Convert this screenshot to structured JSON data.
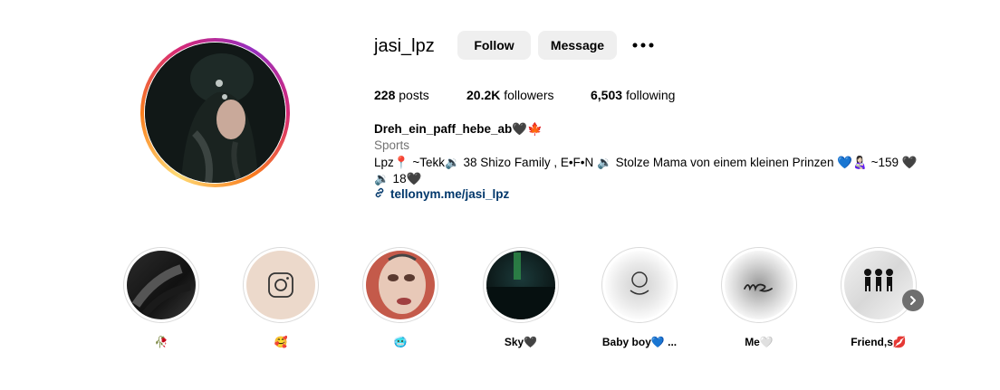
{
  "profile": {
    "username": "jasi_lpz",
    "follow_label": "Follow",
    "message_label": "Message",
    "stats": {
      "posts_count": "228",
      "posts_label": "posts",
      "followers_count": "20.2K",
      "followers_label": "followers",
      "following_count": "6,503",
      "following_label": "following"
    },
    "display_name": "Dreh_ein_paff_hebe_ab🖤🍁",
    "category": "Sports",
    "bio_line1": "Lpz📍 ~Tekk🔉 38 Shizo Family , E•F•N 🔉 Stolze Mama von einem kleinen Prinzen 💙👩🏻‍🍼 ~159 🖤",
    "bio_line2": "🔉 18🖤",
    "link": "tellonym.me/jasi_lpz"
  },
  "highlights": [
    {
      "label": "🥀"
    },
    {
      "label": "🥰"
    },
    {
      "label": "🥶"
    },
    {
      "label": "Sky🖤"
    },
    {
      "label": "Baby boy💙 ..."
    },
    {
      "label": "Me🤍"
    },
    {
      "label": "Friend,s💋"
    }
  ],
  "icons": {
    "more": "more-options-icon",
    "link": "link-icon",
    "next": "chevron-right-icon"
  },
  "colors": {
    "button_bg": "#efefef",
    "link": "#00376b",
    "category": "#737373"
  }
}
